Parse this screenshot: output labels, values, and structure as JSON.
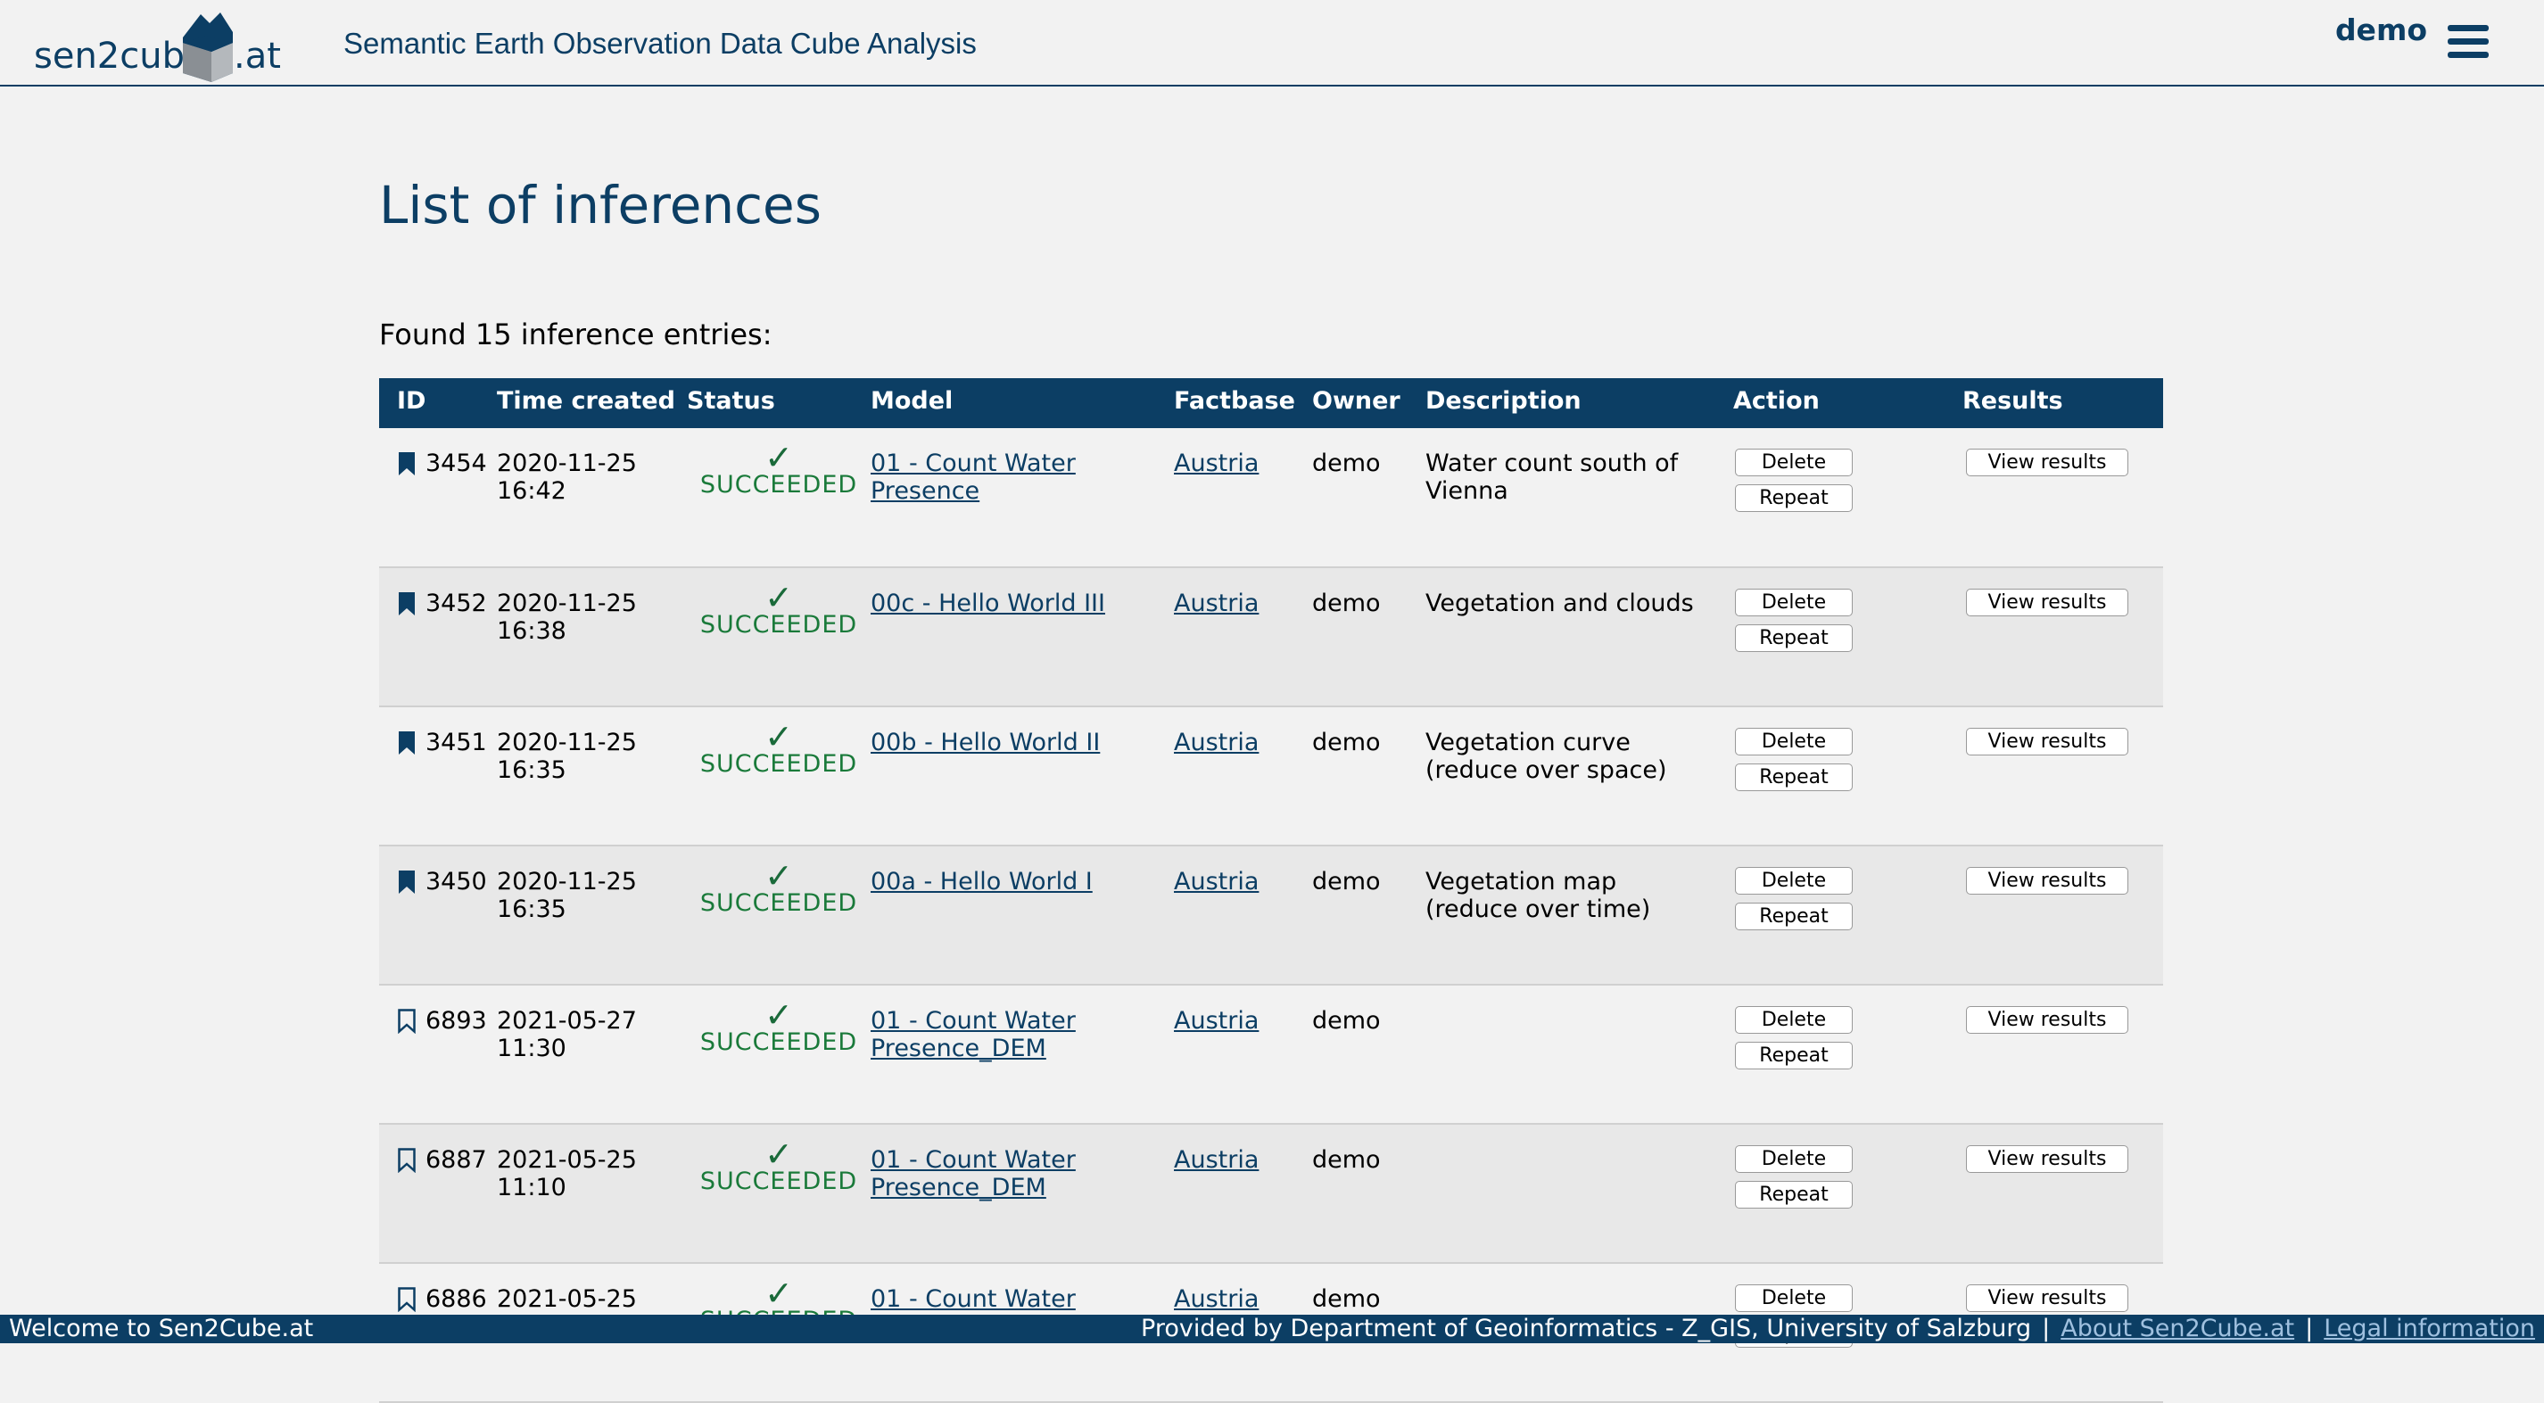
{
  "header": {
    "logo_left": "sen2cube",
    "logo_right": ".at",
    "site_title": "Semantic Earth Observation Data Cube Analysis",
    "user": "demo"
  },
  "page": {
    "title": "List of inferences",
    "found_text": "Found 15 inference entries:"
  },
  "table": {
    "columns": [
      "ID",
      "Time created",
      "Status",
      "Model",
      "Factbase",
      "Owner",
      "Description",
      "Action",
      "Results"
    ],
    "rows": [
      {
        "id": "3454",
        "bookmarked": true,
        "date": "2020-11-25",
        "time": "16:42",
        "status": "SUCCEEDED",
        "model": "01 - Count Water Presence",
        "factbase": "Austria",
        "owner": "demo",
        "description": "Water count south of Vienna"
      },
      {
        "id": "3452",
        "bookmarked": true,
        "date": "2020-11-25",
        "time": "16:38",
        "status": "SUCCEEDED",
        "model": "00c - Hello World III",
        "factbase": "Austria",
        "owner": "demo",
        "description": "Vegetation and clouds"
      },
      {
        "id": "3451",
        "bookmarked": true,
        "date": "2020-11-25",
        "time": "16:35",
        "status": "SUCCEEDED",
        "model": "00b - Hello World II",
        "factbase": "Austria",
        "owner": "demo",
        "description": "Vegetation curve (reduce over space)"
      },
      {
        "id": "3450",
        "bookmarked": true,
        "date": "2020-11-25",
        "time": "16:35",
        "status": "SUCCEEDED",
        "model": "00a - Hello World I",
        "factbase": "Austria",
        "owner": "demo",
        "description": "Vegetation map (reduce over time)"
      },
      {
        "id": "6893",
        "bookmarked": false,
        "date": "2021-05-27",
        "time": "11:30",
        "status": "SUCCEEDED",
        "model": "01 - Count Water Presence_DEM",
        "factbase": "Austria",
        "owner": "demo",
        "description": ""
      },
      {
        "id": "6887",
        "bookmarked": false,
        "date": "2021-05-25",
        "time": "11:10",
        "status": "SUCCEEDED",
        "model": "01 - Count Water Presence_DEM",
        "factbase": "Austria",
        "owner": "demo",
        "description": ""
      },
      {
        "id": "6886",
        "bookmarked": false,
        "date": "2021-05-25",
        "time": "",
        "status": "SUCCEEDED",
        "model": "01 - Count Water",
        "factbase": "Austria",
        "owner": "demo",
        "description": ""
      }
    ],
    "delete_label": "Delete",
    "repeat_label": "Repeat",
    "results_label": "View results",
    "status_icon": "checkmark-icon"
  },
  "footer": {
    "welcome": "Welcome to Sen2Cube.at",
    "provider": "Provided by Department of Geoinformatics - Z_GIS, University of Salzburg",
    "about": "About Sen2Cube.at",
    "legal": "Legal information",
    "separator": "|"
  },
  "colors": {
    "primary": "#0c3e64",
    "success": "#1a7a3a",
    "background": "#f2f2f2"
  }
}
